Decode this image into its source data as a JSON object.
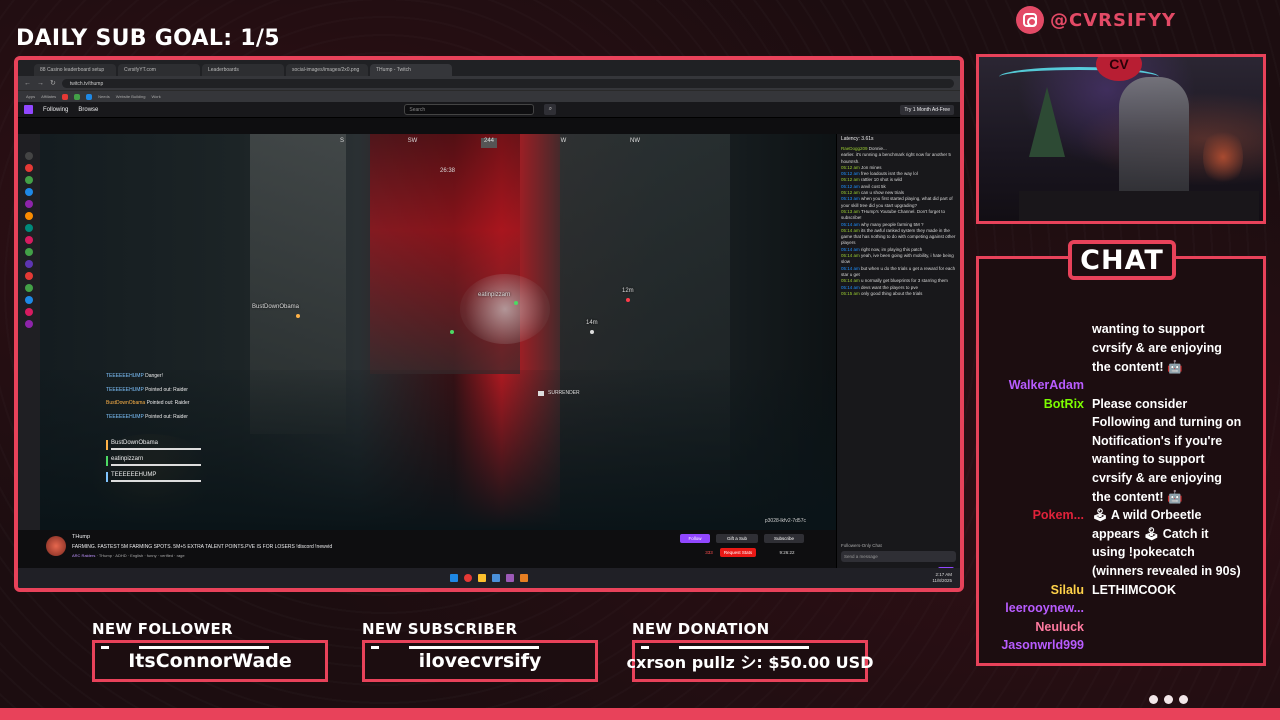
{
  "overlay": {
    "goal_text": "DAILY SUB GOAL: 1/5",
    "social_handle": "@CVRSIFYY",
    "chat_title": "CHAT",
    "accent_color": "#e8425a"
  },
  "alerts": [
    {
      "label": "NEW FOLLOWER",
      "value": "ItsConnorWade"
    },
    {
      "label": "NEW SUBSCRIBER",
      "value": "ilovecvrsify"
    },
    {
      "label": "NEW DONATION",
      "value": "cxrson pullz シ: $50.00 USD"
    }
  ],
  "chat_messages": [
    {
      "name": "",
      "name_color": "#ffffff",
      "text": "wanting to support cvrsify & are enjoying the content! 🤖"
    },
    {
      "name": "WalkerAdam",
      "name_color": "#b85cff",
      "text": ""
    },
    {
      "name": "BotRix",
      "name_color": "#7cfc00",
      "text": "Please consider Following and turning on Notification's if you're wanting to support cvrsify & are enjoying the content! 🤖"
    },
    {
      "name": "Pokem...",
      "name_color": "#e0223a",
      "text": "🕹 A wild Orbeetle appears 🕹 Catch it using !pokecatch (winners revealed in 90s)"
    },
    {
      "name": "Silalu",
      "name_color": "#ffd24a",
      "text": "LETHIMCOOK"
    },
    {
      "name": "leerooynew...",
      "name_color": "#b85cff",
      "text": ""
    },
    {
      "name": "Neuluck",
      "name_color": "#ff7aa0",
      "text": ""
    },
    {
      "name": "Jasonwrld999",
      "name_color": "#b85cff",
      "text": ""
    }
  ],
  "browser": {
    "tabs": [
      "88 Casino leaderboard setup",
      "CvrsifyYT.com",
      "Leaderboards",
      "social-images/images/2x0.png",
      "THump - Twitch"
    ],
    "url": "twitch.tv/thump",
    "bookmarks": [
      "Apps",
      "Affiliates",
      "Needs",
      "Website Building",
      "Work"
    ]
  },
  "twitch": {
    "nav_following": "Following",
    "nav_browse": "Browse",
    "search_placeholder": "Search",
    "turbo": "Try 1 Month Ad-Free",
    "latency": "Latency: 3.61s",
    "channel_name": "THump",
    "stream_title": "FARMING. FASTEST 5M FARMING SPOTS. 5M+5 EXTRA TALENT POINTS.PVE IS FOR LOSERS !discord !newvid",
    "category": "ARC Raiders",
    "tags": "THump · ADHD · English · funny · verified · rage",
    "follow": "Follow",
    "gift": "Gift a Sub",
    "subscribe": "Subscribe",
    "chat_placeholder": "Send a message",
    "chat_button": "Chat",
    "followers_only": "Followers-Only Chat",
    "viewers": "333",
    "request_stats": "Request Stats",
    "uptime": "9:26:22",
    "session_id": "p3028-lkfv2-7d57c",
    "taskbar_time": "2:17 AM",
    "taskbar_date": "11/8/2025"
  },
  "twitch_chat": [
    {
      "user": "RaeDogg209",
      "text": "Donnie..."
    },
    {
      "user": "",
      "text": "earlier. it's running a benchmark right now for another 5 hours!sh."
    },
    {
      "user": "05:12 am",
      "text": "Jon mines"
    },
    {
      "user": "05:12 am",
      "text": "free loadouts isnt the way lol"
    },
    {
      "user": "05:12 am",
      "text": "rattler 10 shot is wild"
    },
    {
      "user": "05:12 am",
      "text": "anvil cost 5k"
    },
    {
      "user": "05:12 am",
      "text": "can u show new trials"
    },
    {
      "user": "05:13 am",
      "text": "when you first started playing, what did part of your skill tree did you start upgrading?"
    },
    {
      "user": "05:13 am",
      "text": "THump's Youtube Channel. Don't forget to subscribe!"
    },
    {
      "user": "05:14 am",
      "text": "why many people farming 5M ?"
    },
    {
      "user": "05:14 am",
      "text": "its the awful ranked system they made in the game that has nothing to do with competing against other players"
    },
    {
      "user": "05:14 am",
      "text": "right now, im playing this patch"
    },
    {
      "user": "05:14 am",
      "text": "yeah, ive been going with mobility, i hate being slow"
    },
    {
      "user": "05:14 am",
      "text": "but when u do the trials u get a reward for each star u get"
    },
    {
      "user": "05:14 am",
      "text": "u normally get blueprints for 3 starring them"
    },
    {
      "user": "05:14 am",
      "text": "devs want the players to pve"
    },
    {
      "user": "05:15 am",
      "text": "only good thing about the trials"
    }
  ],
  "game": {
    "compass": [
      "S",
      "SW",
      "244",
      "W",
      "NW"
    ],
    "timer": "26:38",
    "teammate1": "BustDownObama",
    "teammate2": "eatinpizzarn",
    "teammate3": "TEEEEEEHUMP",
    "dist1": "12m",
    "dist2": "14m",
    "surrender": "SURRENDER",
    "feed": [
      {
        "name": "TEEEEEEHUMP",
        "msg": "Danger!",
        "color": "#7fc4ff"
      },
      {
        "name": "TEEEEEEHUMP",
        "msg": "Pointed out: Raider",
        "color": "#7fc4ff"
      },
      {
        "name": "BustDownObama",
        "msg": "Pointed out: Raider",
        "color": "#ffb247"
      },
      {
        "name": "TEEEEEEHUMP",
        "msg": "Pointed out: Raider",
        "color": "#7fc4ff"
      }
    ]
  }
}
